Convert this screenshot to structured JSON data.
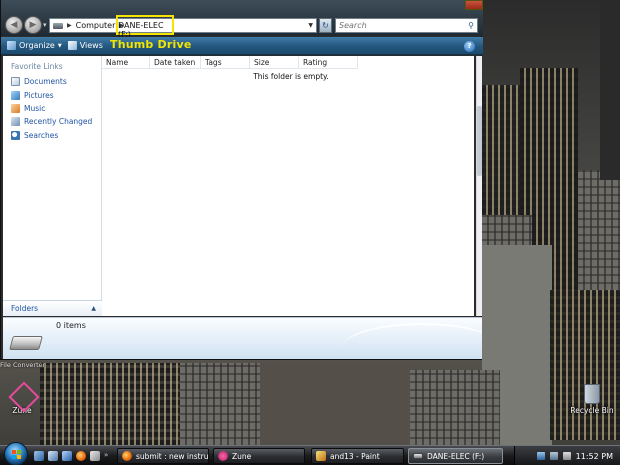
{
  "window": {
    "address": {
      "root_label": "Computer",
      "current_label": "DANE-ELEC (F:)"
    },
    "search": {
      "placeholder": "Search"
    },
    "toolbar": {
      "organize_label": "Organize",
      "views_label": "Views",
      "annotation_label": "Thumb Drive",
      "help_label": "?"
    },
    "nav_pane": {
      "title": "Favorite Links",
      "items": [
        {
          "label": "Documents",
          "icon": "documents-icon"
        },
        {
          "label": "Pictures",
          "icon": "pictures-icon"
        },
        {
          "label": "Music",
          "icon": "music-icon"
        },
        {
          "label": "Recently Changed",
          "icon": "recent-icon"
        },
        {
          "label": "Searches",
          "icon": "searches-icon"
        }
      ],
      "folders_label": "Folders"
    },
    "columns": [
      "Name",
      "Date taken",
      "Tags",
      "Size",
      "Rating"
    ],
    "empty_message": "This folder is empty.",
    "details": {
      "items_count": "0 items"
    }
  },
  "desktop": {
    "icons": [
      {
        "label": "Zune",
        "icon": "zune-icon"
      },
      {
        "label": "Recycle Bin",
        "icon": "recycle-bin-icon"
      }
    ],
    "partial_label": "File Converter"
  },
  "taskbar": {
    "tasks": [
      {
        "label": "submit : new instruc...",
        "icon": "firefox-icon"
      },
      {
        "label": "Zune",
        "icon": "zune-icon"
      },
      {
        "label": "and13 - Paint",
        "icon": "paint-icon"
      },
      {
        "label": "DANE-ELEC (F:)",
        "icon": "drive-icon",
        "active": true
      }
    ],
    "clock": "11:52 PM"
  },
  "colors": {
    "annotation": "#f5e400",
    "toolbar": "#2a5f87",
    "link": "#1f55a3"
  }
}
